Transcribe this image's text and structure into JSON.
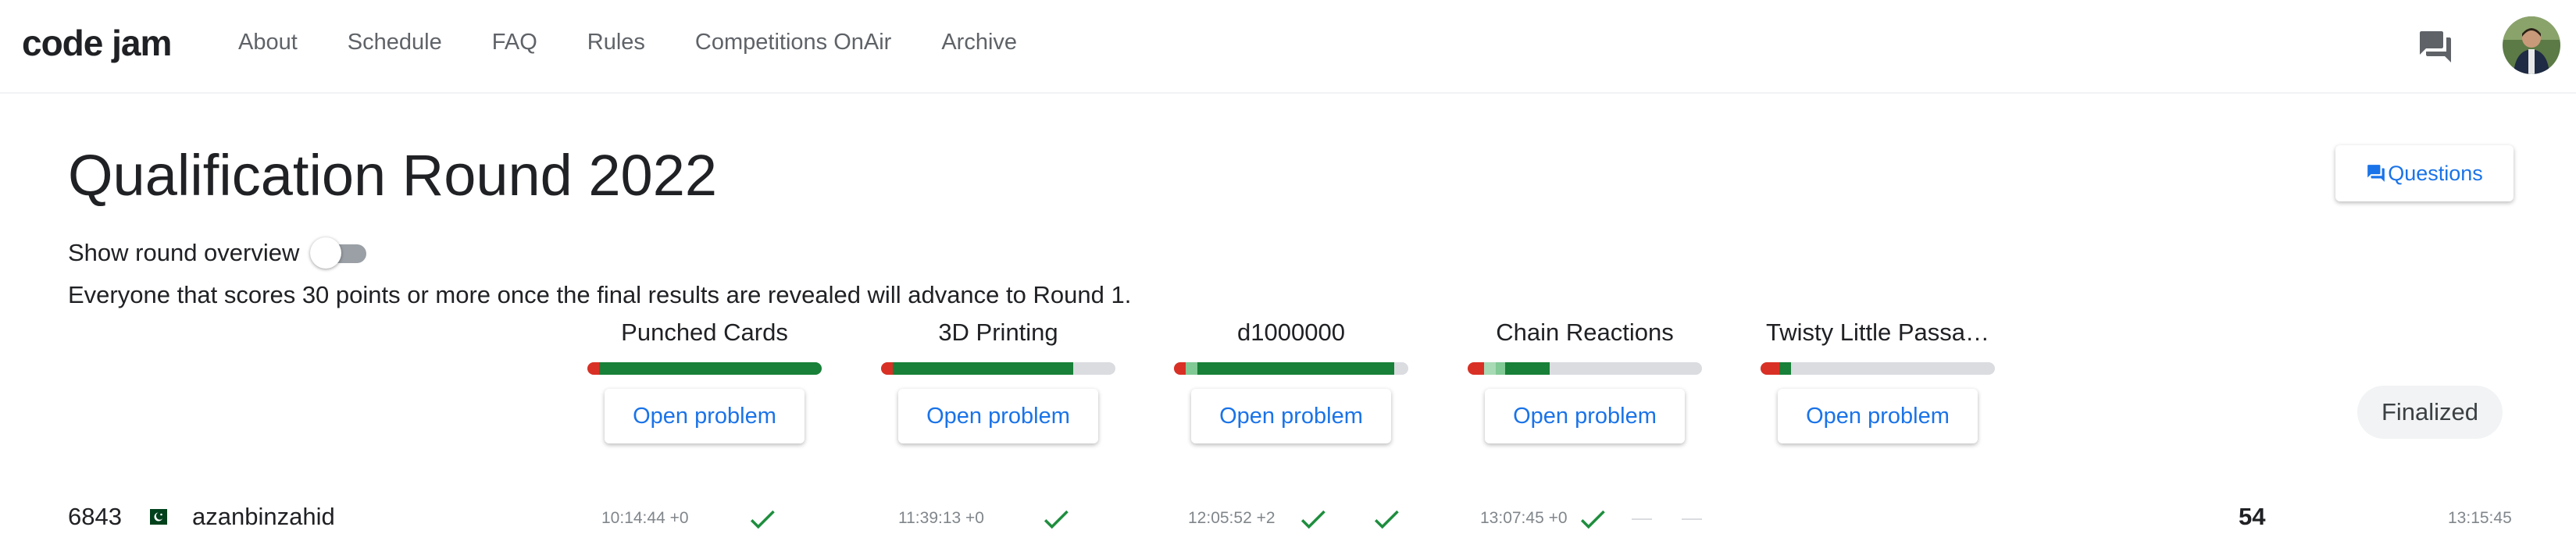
{
  "header": {
    "logo": "code jam",
    "nav": [
      "About",
      "Schedule",
      "FAQ",
      "Rules",
      "Competitions OnAir",
      "Archive"
    ],
    "icons": [
      "forum-icon",
      "avatar"
    ]
  },
  "round": {
    "title": "Qualification Round 2022",
    "questions_label": "Questions",
    "overview_label": "Show round overview",
    "overview_on": false,
    "note": "Everyone that scores 30 points or more once the final results are revealed will advance to Round 1.",
    "status": "Finalized"
  },
  "problems": [
    {
      "title": "Punched Cards",
      "button": "Open problem",
      "progress": [
        {
          "color": "#d93025",
          "frac": 0.05
        },
        {
          "color": "#188038",
          "frac": 0.95
        }
      ]
    },
    {
      "title": "3D Printing",
      "button": "Open problem",
      "progress": [
        {
          "color": "#d93025",
          "frac": 0.05
        },
        {
          "color": "#188038",
          "frac": 0.77
        }
      ]
    },
    {
      "title": "d1000000",
      "button": "Open problem",
      "progress": [
        {
          "color": "#d93025",
          "frac": 0.05
        },
        {
          "color": "#81c995",
          "frac": 0.05
        },
        {
          "color": "#188038",
          "frac": 0.84
        }
      ]
    },
    {
      "title": "Chain Reactions",
      "button": "Open problem",
      "progress": [
        {
          "color": "#d93025",
          "frac": 0.07
        },
        {
          "color": "#a8dab5",
          "frac": 0.05
        },
        {
          "color": "#81c995",
          "frac": 0.04
        },
        {
          "color": "#188038",
          "frac": 0.19
        }
      ]
    },
    {
      "title": "Twisty Little Passa…",
      "button": "Open problem",
      "progress": [
        {
          "color": "#d93025",
          "frac": 0.08
        },
        {
          "color": "#188038",
          "frac": 0.05
        }
      ]
    }
  ],
  "row": {
    "rank": "6843",
    "country": "Pakistan",
    "username": "azanbinzahid",
    "results": [
      {
        "time": "10:14:44 +0",
        "checks": 1,
        "dashes": 0
      },
      {
        "time": "11:39:13 +0",
        "checks": 1,
        "dashes": 0
      },
      {
        "time": "12:05:52 +2",
        "checks": 2,
        "dashes": 0
      },
      {
        "time": "13:07:45 +0",
        "checks": 1,
        "dashes": 2
      },
      {
        "time": "",
        "checks": 0,
        "dashes": 0
      }
    ],
    "score": "54",
    "penalty_time": "13:15:45"
  },
  "colors": {
    "accent": "#1a73e8",
    "correct": "#1e8e3e",
    "wrong": "#d93025"
  }
}
